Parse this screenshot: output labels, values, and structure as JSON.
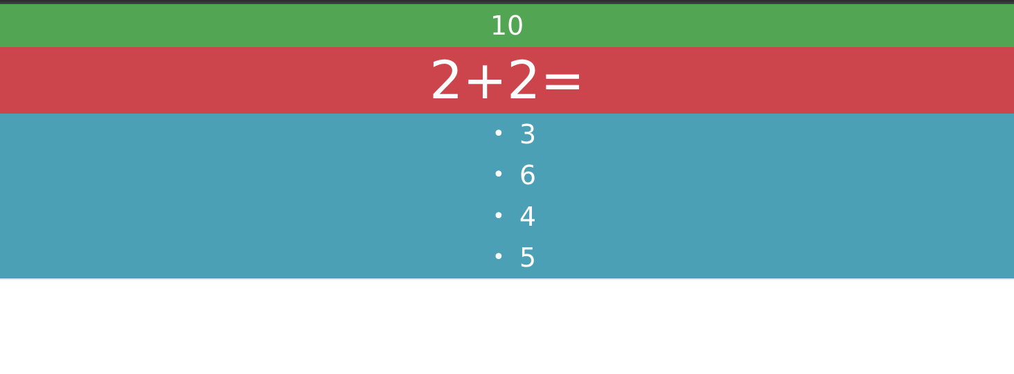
{
  "score": {
    "value": "10"
  },
  "question": {
    "text": "2+2="
  },
  "answers": [
    {
      "label": "3"
    },
    {
      "label": "6"
    },
    {
      "label": "4"
    },
    {
      "label": "5"
    }
  ],
  "colors": {
    "score_bar": "#52a552",
    "question_bar": "#cc454c",
    "answers_panel": "#4ba0b6",
    "text": "#ffffff"
  }
}
